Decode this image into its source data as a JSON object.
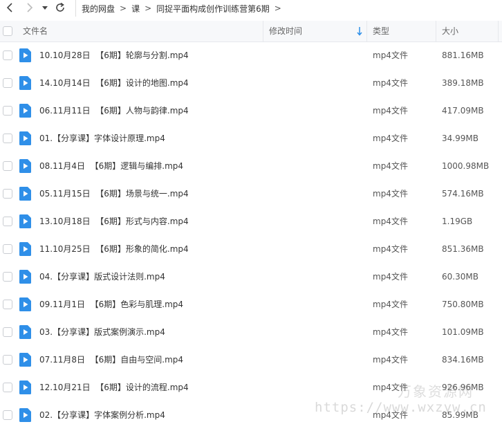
{
  "breadcrumb": [
    "我的网盘",
    "课",
    "同捉平面构成创作训练营第6期"
  ],
  "header": {
    "name": "文件名",
    "mtime": "修改时间",
    "type": "类型",
    "size": "大小"
  },
  "accent_color": "#2f8fe8",
  "files": [
    {
      "name": "10.10月28日  【6期】轮廓与分割.mp4",
      "type": "mp4文件",
      "size": "881.16MB"
    },
    {
      "name": "14.10月14日  【6期】设计的地图.mp4",
      "type": "mp4文件",
      "size": "389.18MB"
    },
    {
      "name": "06.11月11日  【6期】人物与韵律.mp4",
      "type": "mp4文件",
      "size": "417.09MB"
    },
    {
      "name": "01.【分享课】字体设计原理.mp4",
      "type": "mp4文件",
      "size": "34.99MB"
    },
    {
      "name": "08.11月4日  【6期】逻辑与编排.mp4",
      "type": "mp4文件",
      "size": "1000.98MB"
    },
    {
      "name": "05.11月15日  【6期】场景与统一.mp4",
      "type": "mp4文件",
      "size": "574.16MB"
    },
    {
      "name": "13.10月18日  【6期】形式与内容.mp4",
      "type": "mp4文件",
      "size": "1.19GB"
    },
    {
      "name": "11.10月25日  【6期】形象的简化.mp4",
      "type": "mp4文件",
      "size": "851.36MB"
    },
    {
      "name": "04.【分享课】版式设计法则.mp4",
      "type": "mp4文件",
      "size": "60.30MB"
    },
    {
      "name": "09.11月1日  【6期】色彩与肌理.mp4",
      "type": "mp4文件",
      "size": "750.80MB"
    },
    {
      "name": "03.【分享课】版式案例演示.mp4",
      "type": "mp4文件",
      "size": "101.09MB"
    },
    {
      "name": "07.11月8日  【6期】自由与空间.mp4",
      "type": "mp4文件",
      "size": "834.16MB"
    },
    {
      "name": "12.10月21日  【6期】设计的流程.mp4",
      "type": "mp4文件",
      "size": "926.96MB"
    },
    {
      "name": "02.【分享课】字体案例分析.mp4",
      "type": "mp4文件",
      "size": "85.99MB"
    }
  ],
  "watermark": {
    "line1": "万象资源网",
    "line2": "https://www.wxzyw.cn"
  }
}
